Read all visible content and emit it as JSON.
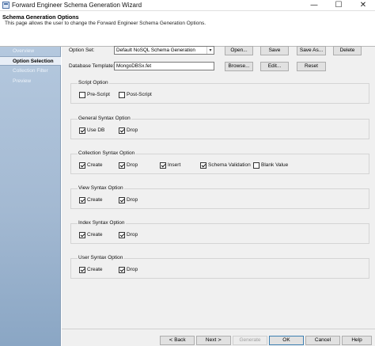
{
  "window": {
    "title": "Forward Engineer Schema Generation Wizard",
    "minimize_glyph": "—",
    "maximize_glyph": "☐",
    "close_glyph": "✕"
  },
  "header": {
    "title": "Schema Generation Options",
    "subtitle": "This page allows the user to change the Forward Engineer Schema Generation Options."
  },
  "sidebar": {
    "items": [
      {
        "label": "Overview",
        "active": false
      },
      {
        "label": "Option Selection",
        "active": true
      },
      {
        "label": "Collection Filter",
        "active": false
      },
      {
        "label": "Preview",
        "active": false
      }
    ]
  },
  "option_set": {
    "label": "Option Set:",
    "value": "Default NoSQL Schema Generation",
    "buttons": {
      "open": "Open...",
      "save": "Save",
      "save_as": "Save As...",
      "delete": "Delete"
    }
  },
  "database_template": {
    "label": "Database Template:",
    "value": "MongoDBSx.fet",
    "buttons": {
      "browse": "Browse...",
      "edit": "Edit...",
      "reset": "Reset"
    }
  },
  "groups": {
    "script": {
      "title": "Script Option",
      "options": [
        {
          "label": "Pre-Script",
          "checked": false
        },
        {
          "label": "Post-Script",
          "checked": false
        }
      ]
    },
    "general": {
      "title": "General Syntax Option",
      "options": [
        {
          "label": "Use DB",
          "checked": true
        },
        {
          "label": "Drop",
          "checked": true
        }
      ]
    },
    "collection": {
      "title": "Collection Syntax Option",
      "options": [
        {
          "label": "Create",
          "checked": true
        },
        {
          "label": "Drop",
          "checked": true
        },
        {
          "label": "Insert",
          "checked": true
        },
        {
          "label": "Schema Validation",
          "checked": true
        },
        {
          "label": "Blank Value",
          "checked": false
        }
      ]
    },
    "view": {
      "title": "View Syntax Option",
      "options": [
        {
          "label": "Create",
          "checked": true
        },
        {
          "label": "Drop",
          "checked": true
        }
      ]
    },
    "index": {
      "title": "Index Syntax Option",
      "options": [
        {
          "label": "Create",
          "checked": true
        },
        {
          "label": "Drop",
          "checked": true
        }
      ]
    },
    "user": {
      "title": "User Syntax Option",
      "options": [
        {
          "label": "Create",
          "checked": true
        },
        {
          "label": "Drop",
          "checked": true
        }
      ]
    }
  },
  "footer": {
    "back": "Back",
    "back_glyph": "<",
    "next": "Next",
    "next_glyph": ">",
    "generate": "Generate",
    "ok": "OK",
    "cancel": "Cancel",
    "help": "Help"
  }
}
